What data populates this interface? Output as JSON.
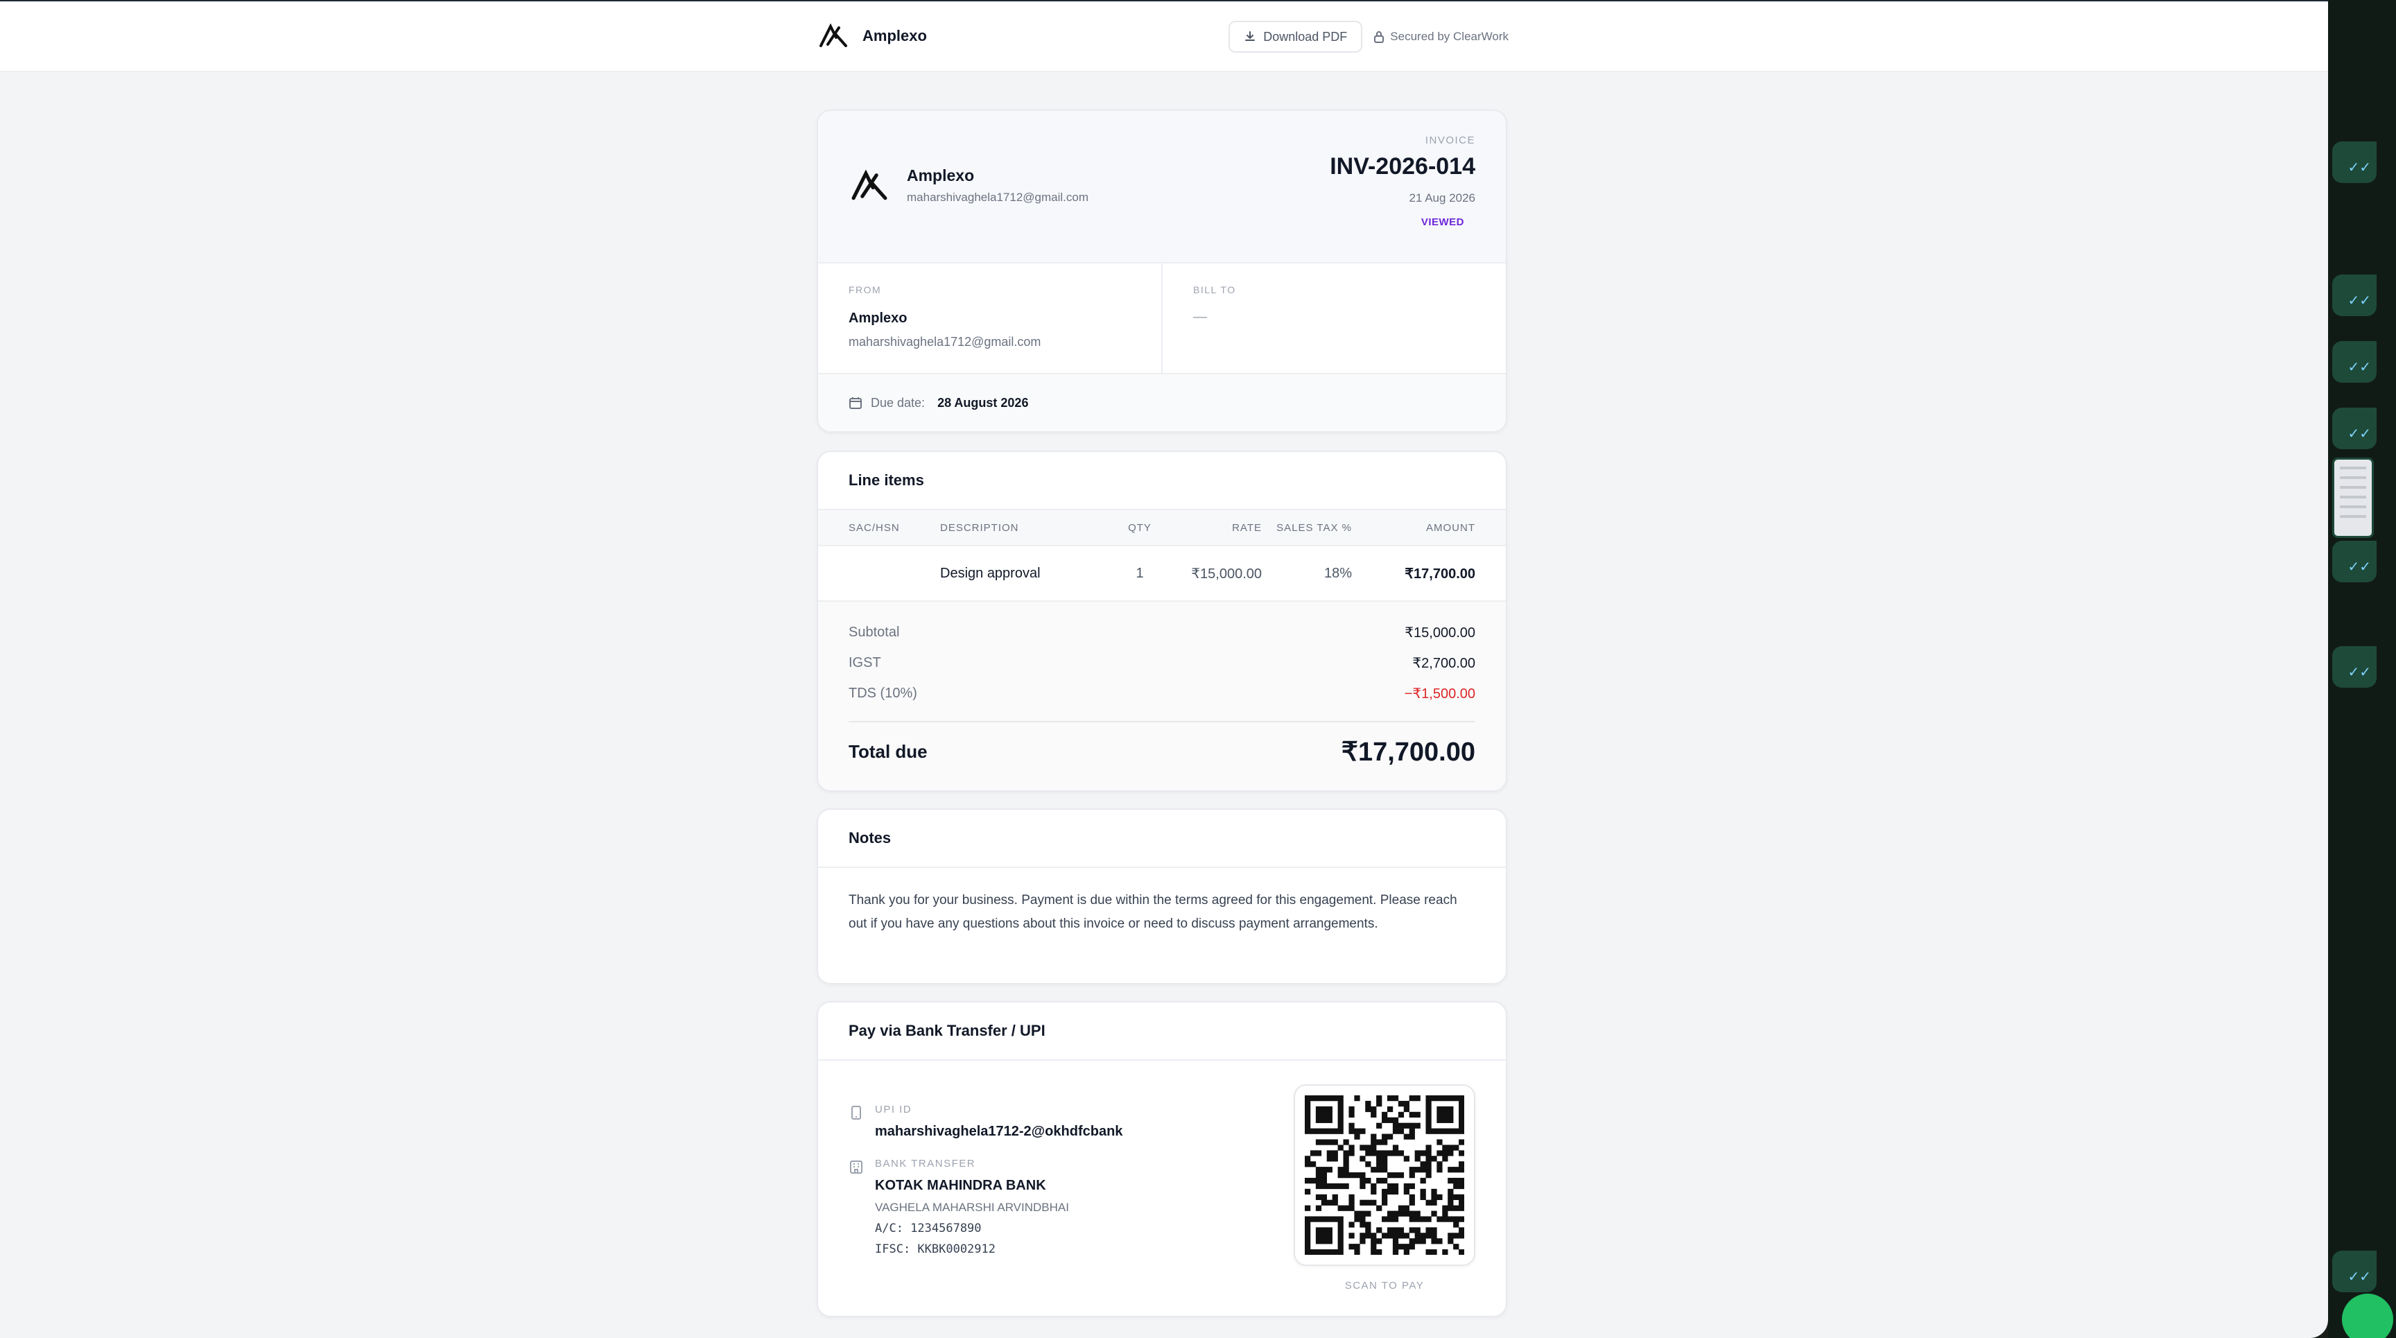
{
  "topbar": {
    "brand_name": "Amplexo",
    "download_label": "Download PDF",
    "secured_label": "Secured by ClearWork"
  },
  "invoice": {
    "sender_name": "Amplexo",
    "sender_email": "maharshivaghela1712@gmail.com",
    "label": "INVOICE",
    "number": "INV-2026-014",
    "date": "21 Aug 2026",
    "status": "VIEWED",
    "from_label": "FROM",
    "from_name": "Amplexo",
    "from_email": "maharshivaghela1712@gmail.com",
    "bill_to_label": "BILL TO",
    "bill_to_value": "—",
    "due_label": "Due date:",
    "due_date": "28 August 2026"
  },
  "line_items": {
    "title": "Line items",
    "columns": {
      "sac": "SAC/HSN",
      "description": "DESCRIPTION",
      "qty": "QTY",
      "rate": "RATE",
      "tax": "SALES TAX %",
      "amount": "AMOUNT"
    },
    "rows": [
      {
        "sac": "",
        "description": "Design approval",
        "qty": "1",
        "rate": "₹15,000.00",
        "tax": "18%",
        "amount": "₹17,700.00"
      }
    ]
  },
  "totals": {
    "subtotal_label": "Subtotal",
    "subtotal": "₹15,000.00",
    "igst_label": "IGST",
    "igst": "₹2,700.00",
    "tds_label": "TDS (10%)",
    "tds": "−₹1,500.00",
    "total_label": "Total due",
    "total": "₹17,700.00"
  },
  "notes": {
    "title": "Notes",
    "text": "Thank you for your business. Payment is due within the terms agreed for this engagement. Please reach out if you have any questions about this invoice or need to discuss payment arrangements."
  },
  "payment": {
    "title": "Pay via Bank Transfer / UPI",
    "upi_label": "UPI ID",
    "upi_id": "maharshivaghela1712-2@okhdfcbank",
    "bank_label": "BANK TRANSFER",
    "bank_name": "KOTAK MAHINDRA BANK",
    "account_holder": "VAGHELA MAHARSHI ARVINDBHAI",
    "account_number": "A/C: 1234567890",
    "ifsc": "IFSC: KKBK0002912",
    "qr_caption": "SCAN TO PAY"
  },
  "colors": {
    "accent_status": "#6d28d9",
    "negative": "#dc2626",
    "page_bg": "#f3f4f6"
  }
}
